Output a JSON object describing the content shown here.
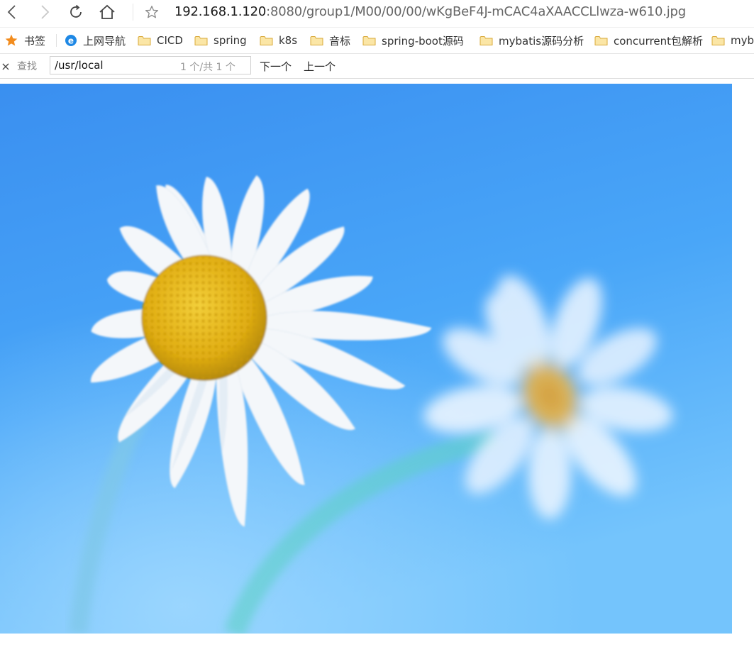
{
  "address": {
    "host": "192.168.1.120",
    "path": ":8080/group1/M00/00/00/wKgBeF4J-mCAC4aXAACCLlwza-w610.jpg"
  },
  "icons": {
    "back": "chevron-left-icon",
    "forward": "chevron-right-icon",
    "reload": "reload-icon",
    "home": "home-icon",
    "star": "star-outline-icon"
  },
  "bookmarks": {
    "label": "书签",
    "items": [
      {
        "label": "上网导航",
        "icon": "ie-icon"
      },
      {
        "label": "CICD",
        "icon": "folder-icon"
      },
      {
        "label": "spring",
        "icon": "folder-icon"
      },
      {
        "label": "k8s",
        "icon": "folder-icon"
      },
      {
        "label": "音标",
        "icon": "folder-icon"
      },
      {
        "label": "spring-boot源码",
        "icon": "folder-icon"
      },
      {
        "label": "mybatis源码分析",
        "icon": "folder-icon"
      },
      {
        "label": "concurrent包解析",
        "icon": "folder-icon"
      },
      {
        "label": "myb",
        "icon": "folder-icon"
      }
    ]
  },
  "find": {
    "close": "×",
    "label": "查找",
    "query": "/usr/local",
    "count": "1 个/共 1 个",
    "next": "下一个",
    "prev": "上一个"
  },
  "colors": {
    "sky_blue": "#3a92f2",
    "petal_white": "#f4f7fa",
    "flower_center": "#e0b010",
    "star_orange": "#f28c1e",
    "folder_yellow": "#f7d77a"
  }
}
